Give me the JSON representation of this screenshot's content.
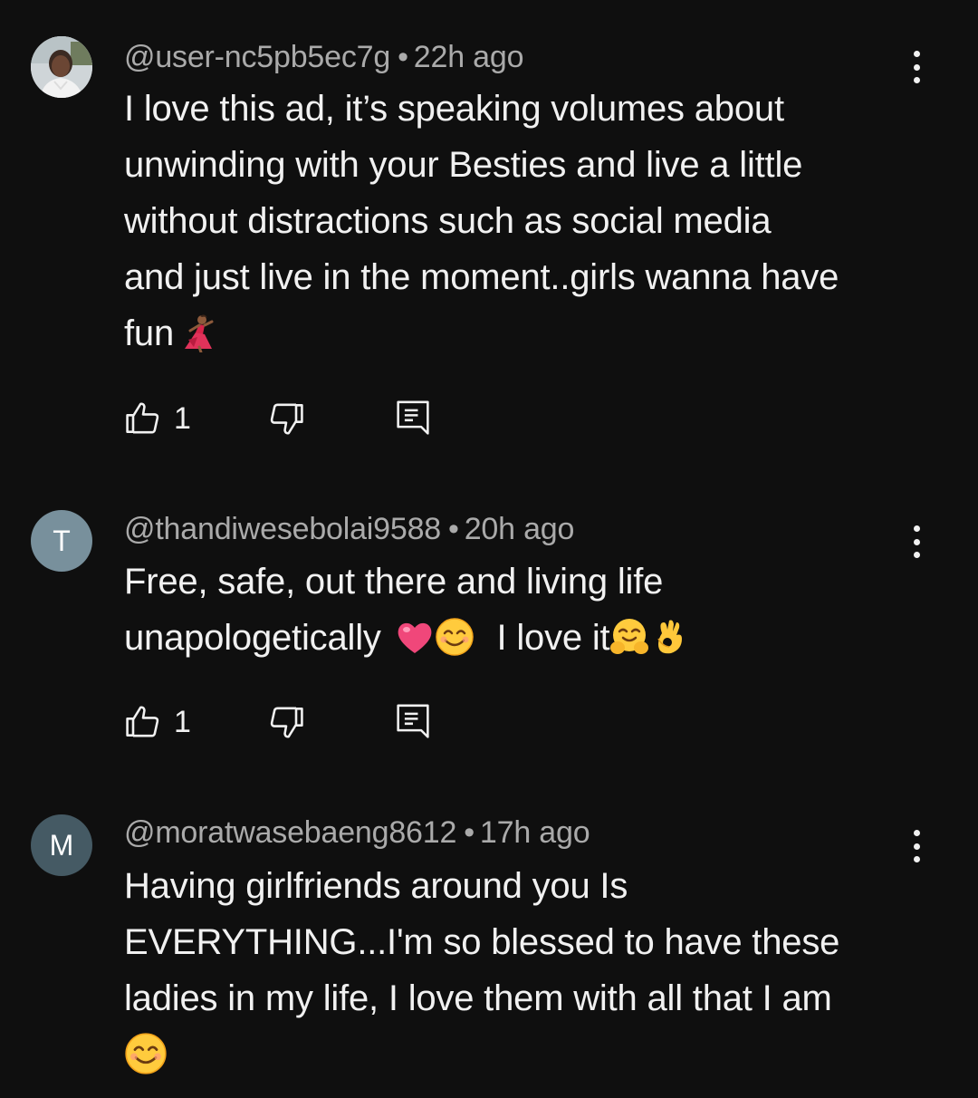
{
  "comments": [
    {
      "username": "@user-nc5pb5ec7g",
      "time": "22h ago",
      "avatar_type": "photo",
      "avatar_letter": "",
      "avatar_color": "#5b6b52",
      "lines": [
        "I love this ad, it’s speaking volumes about",
        "unwinding with your Besties and live a little",
        "without distractions such as social media",
        "and just live in the moment..girls wanna have",
        "fun"
      ],
      "emojis": [
        "dancer-emoji"
      ],
      "likes": "1"
    },
    {
      "username": "@thandiwesebolai9588",
      "time": "20h ago",
      "avatar_type": "letter",
      "avatar_letter": "T",
      "avatar_color": "#78909c",
      "lines": [
        "Free, safe, out there and living life",
        "unapologetically",
        "I love it"
      ],
      "emojis": [
        "heart-emoji",
        "smile-emoji",
        "hug-emoji",
        "ok-hand-emoji"
      ],
      "likes": "1"
    },
    {
      "username": "@moratwasebaeng8612",
      "time": "17h ago",
      "avatar_type": "letter",
      "avatar_letter": "M",
      "avatar_color": "#455a64",
      "lines": [
        "Having girlfriends around you Is",
        "EVERYTHING...I'm so blessed to have these",
        "ladies in my life, I love them with all that I am"
      ],
      "emojis": [
        "smile-emoji"
      ],
      "likes": ""
    }
  ],
  "icons": {
    "like": "thumbs-up-icon",
    "dislike": "thumbs-down-icon",
    "reply": "reply-icon",
    "more": "more-vert-icon"
  },
  "colors": {
    "background": "#0f0f0f",
    "text": "#f1f1f1",
    "meta": "#aaaaaa"
  }
}
